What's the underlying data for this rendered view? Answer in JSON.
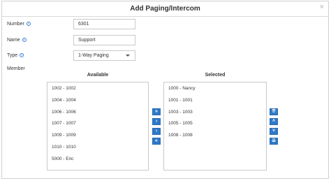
{
  "dialog": {
    "title": "Add Paging/Intercom",
    "close_glyph": "×"
  },
  "form": {
    "number_label": "Number",
    "number_value": "6301",
    "name_label": "Name",
    "name_value": "Support",
    "type_label": "Type",
    "type_value": "1-Way Paging",
    "member_label": "Member",
    "info_glyph": "i"
  },
  "available": {
    "heading": "Available",
    "items": [
      "1002 - 1002",
      "1004 - 1004",
      "1006 - 1006",
      "1007 - 1007",
      "1009 - 1009",
      "1010 - 1010",
      "5000 - Eric"
    ]
  },
  "selected": {
    "heading": "Selected",
    "items": [
      "1000 - Nancy",
      "1001 - 1001",
      "1003 - 1003",
      "1005 - 1005",
      "1008 - 1008"
    ]
  },
  "transfer_buttons": {
    "add_all": "»",
    "add": "›",
    "remove": "‹",
    "remove_all": "«"
  },
  "order_buttons": {
    "top": "⇈",
    "up": "˄",
    "down": "˅",
    "bottom": "⇊"
  },
  "colors": {
    "accent": "#2e79c7",
    "info": "#3a7fd5"
  }
}
